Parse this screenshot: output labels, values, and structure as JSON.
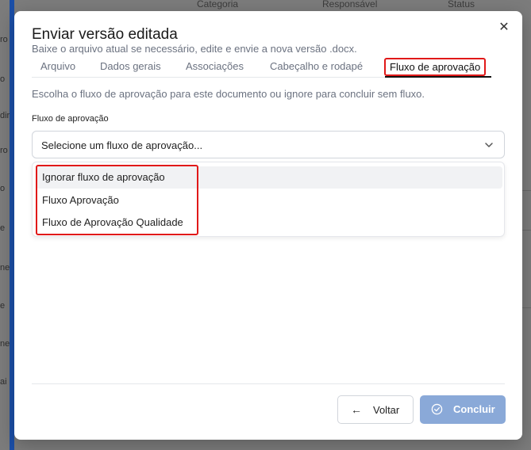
{
  "background": {
    "columns": [
      "Categoria",
      "Responsável",
      "Status"
    ],
    "left_fragments": [
      "ro",
      "o",
      "dir",
      "ro",
      "o",
      "e",
      "ne",
      "e",
      "ne",
      "ai"
    ]
  },
  "modal": {
    "title": "Enviar versão editada",
    "subtitle": "Baixe o arquivo atual se necessário, edite e envie a nova versão .docx.",
    "close_icon": "close-icon",
    "tabs": [
      {
        "label": "Arquivo"
      },
      {
        "label": "Dados gerais"
      },
      {
        "label": "Associações"
      },
      {
        "label": "Cabeçalho e rodapé"
      },
      {
        "label": "Fluxo de aprovação",
        "active": true
      }
    ],
    "helper_text": "Escolha o fluxo de aprovação para este documento ou ignore para concluir sem fluxo.",
    "field_label": "Fluxo de aprovação",
    "select_placeholder": "Selecione um fluxo de aprovação...",
    "options": [
      {
        "label": "Ignorar fluxo de aprovação"
      },
      {
        "label": "Fluxo Aprovação"
      },
      {
        "label": "Fluxo de Aprovação Qualidade"
      }
    ],
    "back_button": "Voltar",
    "done_button": "Concluir"
  },
  "colors": {
    "accent_disabled": "#8aa9d8",
    "annotation_red": "#e11919"
  }
}
